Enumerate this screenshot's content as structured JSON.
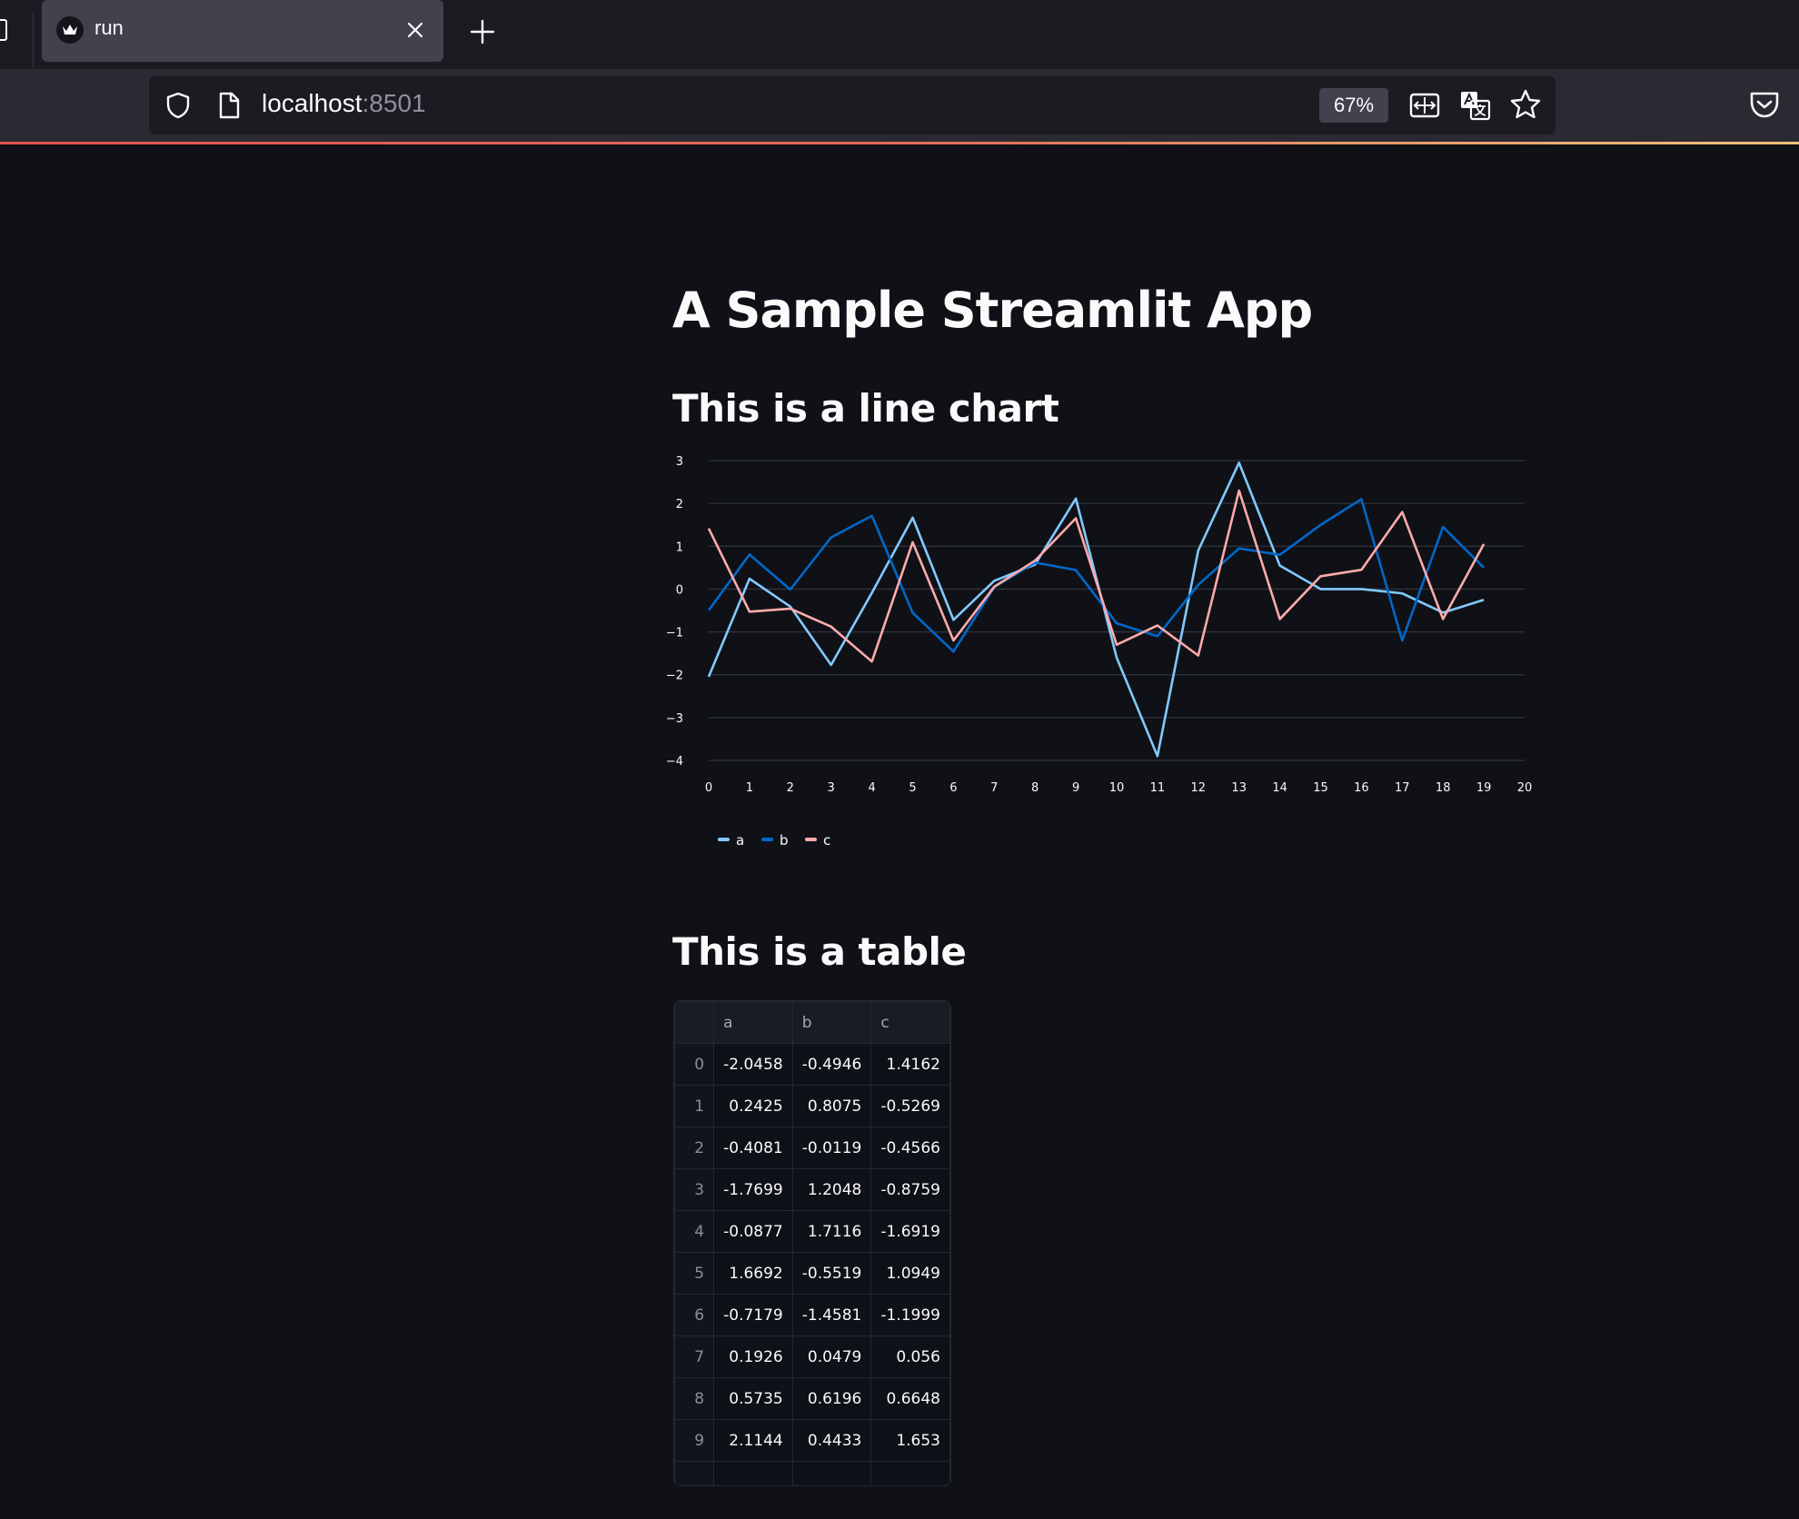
{
  "browser": {
    "tab_title": "run",
    "url_host": "localhost",
    "url_port": ":8501",
    "zoom": "67%"
  },
  "page": {
    "title": "A Sample Streamlit App",
    "chart_heading": "This is a line chart",
    "table_heading": "This is a table"
  },
  "colors": {
    "a": "#83c9ff",
    "b": "#0068c9",
    "c": "#ffabab"
  },
  "chart_data": {
    "type": "line",
    "x": [
      0,
      1,
      2,
      3,
      4,
      5,
      6,
      7,
      8,
      9,
      10,
      11,
      12,
      13,
      14,
      15,
      16,
      17,
      18,
      19
    ],
    "series": [
      {
        "name": "a",
        "values": [
          -2.0458,
          0.2425,
          -0.4081,
          -1.7699,
          -0.0877,
          1.6692,
          -0.7179,
          0.1926,
          0.5735,
          2.1144,
          -1.6,
          -3.9,
          0.9,
          2.95,
          0.55,
          0.0,
          0.0,
          -0.1,
          -0.55,
          -0.25
        ]
      },
      {
        "name": "b",
        "values": [
          -0.4946,
          0.8075,
          -0.0119,
          1.2048,
          1.7116,
          -0.5519,
          -1.4581,
          0.0479,
          0.6196,
          0.4433,
          -0.8,
          -1.1,
          0.1,
          0.95,
          0.8,
          1.5,
          2.1,
          -1.2,
          1.45,
          0.5
        ]
      },
      {
        "name": "c",
        "values": [
          1.4162,
          -0.5269,
          -0.4566,
          -0.8759,
          -1.6919,
          1.0949,
          -1.1999,
          0.056,
          0.6648,
          1.653,
          -1.3,
          -0.85,
          -1.55,
          2.3,
          -0.7,
          0.3,
          0.45,
          1.8,
          -0.7,
          1.05
        ]
      }
    ],
    "x_ticks": [
      "0",
      "1",
      "2",
      "3",
      "4",
      "5",
      "6",
      "7",
      "8",
      "9",
      "10",
      "11",
      "12",
      "13",
      "14",
      "15",
      "16",
      "17",
      "18",
      "19",
      "20"
    ],
    "y_ticks": [
      "3",
      "2",
      "1",
      "0",
      "−1",
      "−2",
      "−3",
      "−4"
    ],
    "xlim": [
      0,
      20
    ],
    "ylim": [
      -4,
      3
    ],
    "grid": true,
    "legend": [
      "a",
      "b",
      "c"
    ],
    "legend_position": "bottom-left"
  },
  "table": {
    "columns": [
      "",
      "a",
      "b",
      "c"
    ],
    "rows": [
      [
        "0",
        "-2.0458",
        "-0.4946",
        "1.4162"
      ],
      [
        "1",
        "0.2425",
        "0.8075",
        "-0.5269"
      ],
      [
        "2",
        "-0.4081",
        "-0.0119",
        "-0.4566"
      ],
      [
        "3",
        "-1.7699",
        "1.2048",
        "-0.8759"
      ],
      [
        "4",
        "-0.0877",
        "1.7116",
        "-1.6919"
      ],
      [
        "5",
        "1.6692",
        "-0.5519",
        "1.0949"
      ],
      [
        "6",
        "-0.7179",
        "-1.4581",
        "-1.1999"
      ],
      [
        "7",
        "0.1926",
        "0.0479",
        "0.056"
      ],
      [
        "8",
        "0.5735",
        "0.6196",
        "0.6648"
      ],
      [
        "9",
        "2.1144",
        "0.4433",
        "1.653"
      ]
    ]
  }
}
